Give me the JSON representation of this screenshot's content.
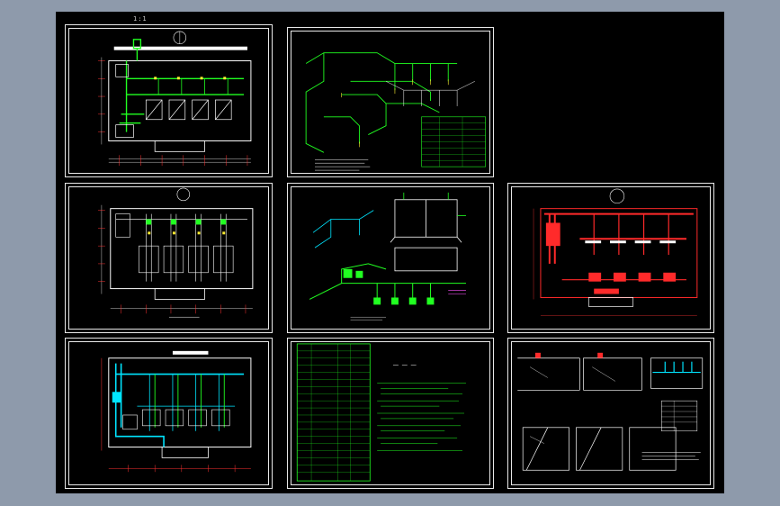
{
  "canvas": {
    "label": "1:1"
  },
  "sheets": [
    {
      "id": "s1",
      "name": "plan-green-pipes"
    },
    {
      "id": "s2",
      "name": "isometric-pipes-green"
    },
    {
      "id": "s3",
      "name": "plan-white-equipment"
    },
    {
      "id": "s4",
      "name": "isometric-section-mixed"
    },
    {
      "id": "s5",
      "name": "plan-red-pipes"
    },
    {
      "id": "s6",
      "name": "plan-cyan-pipes"
    },
    {
      "id": "s7",
      "name": "equipment-table-notes"
    },
    {
      "id": "s8",
      "name": "section-details"
    }
  ],
  "colors": {
    "background": "#8e9aab",
    "canvas": "#000000",
    "line": "#ffffff",
    "green": "#21ff21",
    "cyan": "#00e5ff",
    "red": "#ff2a2a",
    "yellow": "#ffee33",
    "magenta": "#ff55ff"
  }
}
